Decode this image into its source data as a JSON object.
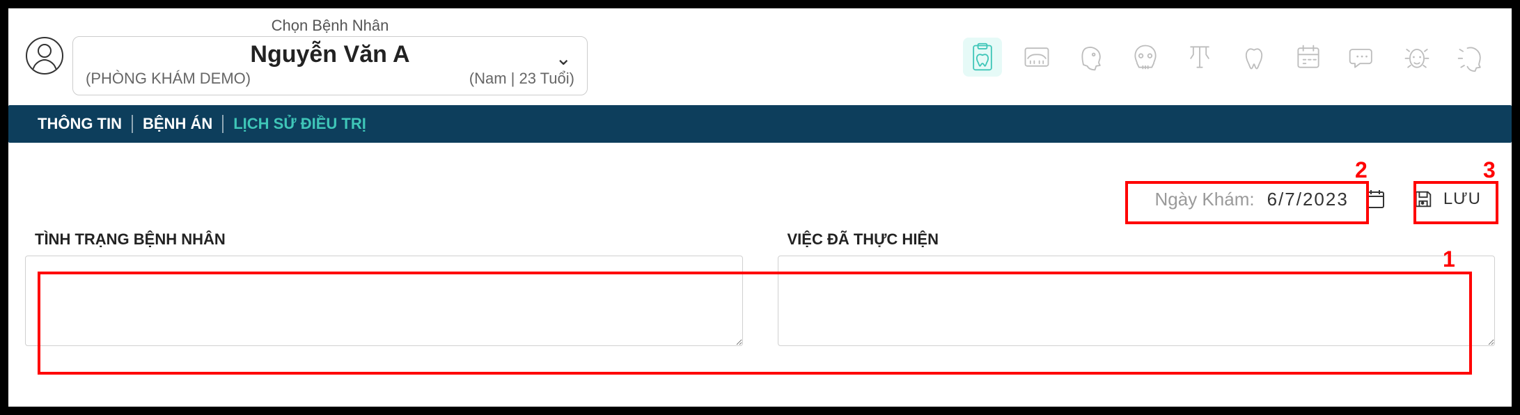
{
  "patientSelector": {
    "label": "Chọn Bệnh Nhân",
    "name": "Nguyễn Văn A",
    "clinic": "(PHÒNG KHÁM DEMO)",
    "genderAge": "(Nam | 23 Tuổi)"
  },
  "tabs": {
    "info": "THÔNG TIN",
    "record": "BỆNH ÁN",
    "history": "LỊCH SỬ ĐIỀU TRỊ"
  },
  "dateRow": {
    "label": "Ngày Khám:",
    "value": "6/7/2023",
    "saveLabel": "LƯU"
  },
  "columns": {
    "conditionLabel": "TÌNH TRẠNG BỆNH NHÂN",
    "conditionValue": "",
    "doneLabel": "VIỆC ĐÃ THỰC HIỆN",
    "doneValue": ""
  },
  "annotations": {
    "n1": "1",
    "n2": "2",
    "n3": "3"
  },
  "toolbarIcons": [
    "clipboard-tooth-icon",
    "panorama-xray-icon",
    "lateral-skull-icon",
    "front-skull-icon",
    "caliper-icon",
    "tooth-icon",
    "calendar-icon",
    "chat-icon",
    "face-front-icon",
    "face-side-icon"
  ]
}
